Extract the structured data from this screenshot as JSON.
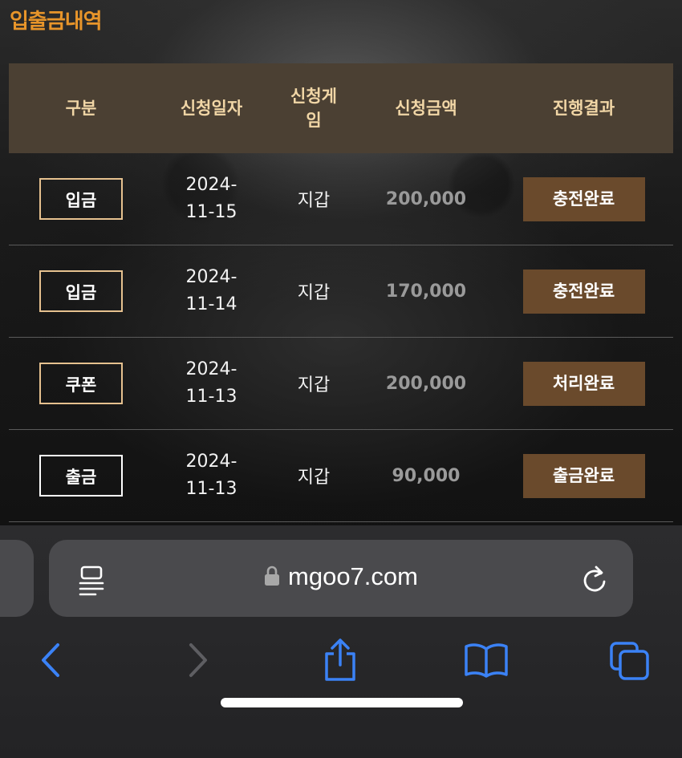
{
  "page_title": "입출금내역",
  "table": {
    "headers": [
      "구분",
      "신청일자",
      "신청게임",
      "신청금액",
      "진행결과"
    ],
    "header_game_line1": "신청게",
    "header_game_line2": "임",
    "rows": [
      {
        "type": "입금",
        "date_l1": "2024-",
        "date_l2": "11-15",
        "game": "지갑",
        "amount": "200,000",
        "status": "충전완료"
      },
      {
        "type": "입금",
        "date_l1": "2024-",
        "date_l2": "11-14",
        "game": "지갑",
        "amount": "170,000",
        "status": "충전완료"
      },
      {
        "type": "쿠폰",
        "date_l1": "2024-",
        "date_l2": "11-13",
        "game": "지갑",
        "amount": "200,000",
        "status": "처리완료"
      },
      {
        "type": "출금",
        "date_l1": "2024-",
        "date_l2": "11-13",
        "game": "지갑",
        "amount": "90,000",
        "status": "출금완료"
      }
    ]
  },
  "browser": {
    "url": "mgoo7.com",
    "icons": [
      "reader-icon",
      "lock-icon",
      "reload-icon",
      "back-icon",
      "forward-icon",
      "share-icon",
      "bookmarks-icon",
      "tabs-icon"
    ]
  },
  "colors": {
    "title": "#e8952a",
    "header_bg": "#4b4033",
    "header_text": "#f1d6a6",
    "status_bg": "#6a4a2c",
    "type_border": "#e6c18f",
    "safari_blue": "#3b82f6"
  }
}
